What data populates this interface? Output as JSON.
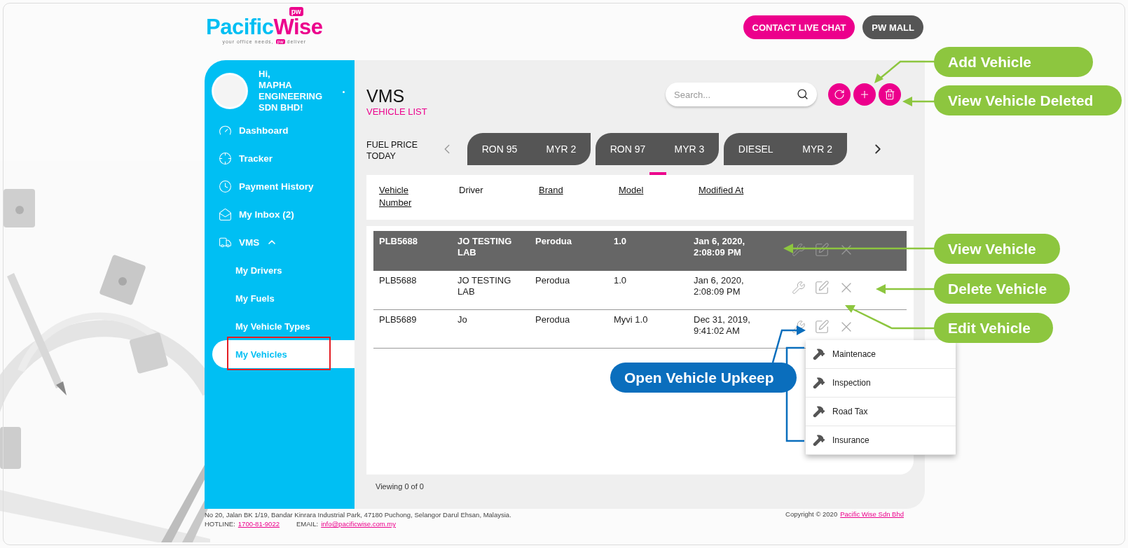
{
  "header": {
    "logo": {
      "word_1": "Pacific",
      "word_2": "Wise",
      "badge": "pw",
      "tagline_start": "your office needs,",
      "tagline_badge": "pw",
      "tagline_end": "deliver"
    },
    "buttons": [
      {
        "label": "CONTACT LIVE CHAT",
        "kind": "primary"
      },
      {
        "label": "PW MALL",
        "kind": "dark"
      }
    ]
  },
  "sidebar": {
    "greeting": [
      "Hi,",
      "MAPHA ENGINEERING SDN BHD!"
    ],
    "items": [
      {
        "label": "Dashboard",
        "selected": false
      },
      {
        "label": "Tracker",
        "selected": false
      },
      {
        "label": "Payment History",
        "selected": false
      },
      {
        "label": "My Inbox (2)",
        "selected": false
      },
      {
        "label": "VMS",
        "selected": false,
        "expanded": true,
        "children": [
          {
            "label": "My Drivers",
            "selected": false,
            "marked": false
          },
          {
            "label": "My Fuels",
            "selected": false,
            "marked": false
          },
          {
            "label": "My Vehicle Types",
            "selected": false,
            "marked": false
          },
          {
            "label": "My Vehicles",
            "selected": true,
            "marked": true
          }
        ]
      }
    ]
  },
  "content": {
    "title": "VMS",
    "subtitle": "VEHICLE LIST",
    "search": {
      "placeholder": "Search..."
    },
    "fuel": {
      "label": "FUEL PRICE TODAY",
      "prices": [
        {
          "fuel": "RON 95",
          "price": "MYR 2",
          "selected": false
        },
        {
          "fuel": "RON 97",
          "price": "MYR 3",
          "selected": true
        },
        {
          "fuel": "DIESEL",
          "price": "MYR 2",
          "selected": false
        }
      ]
    },
    "table": {
      "columns": [
        {
          "label": "Vehicle Number",
          "sortable": true
        },
        {
          "label": "Driver",
          "sortable": false
        },
        {
          "label": "Brand",
          "sortable": true
        },
        {
          "label": "Model",
          "sortable": true
        },
        {
          "label": "Modified At",
          "sortable": true
        }
      ],
      "rows": [
        {
          "cells": [
            "PLB5688",
            "JO TESTING LAB",
            "Perodua",
            "1.0",
            "Jan 6, 2020, 2:08:09 PM"
          ],
          "selected": true
        },
        {
          "cells": [
            "PLB5688",
            "JO TESTING LAB",
            "Perodua",
            "1.0",
            "Jan 6, 2020, 2:08:09 PM"
          ],
          "selected": false
        },
        {
          "cells": [
            "PLB5689",
            "Jo",
            "Perodua",
            "Myvi 1.0",
            "Dec 31, 2019, 9:41:02 AM"
          ],
          "selected": false
        }
      ]
    },
    "upkeep_menu": [
      "Maintenace",
      "Inspection",
      "Road Tax",
      "Insurance"
    ],
    "status": "Viewing 0 of 0"
  },
  "footer": {
    "address": "No 20, Jalan BK 1/19, Bandar Kinrara Industrial Park, 47180 Puchong, Selangor Darul Ehsan, Malaysia.",
    "hotline_label": "HOTLINE:",
    "hotline": "1700-81-9022",
    "email_label": "EMAIL:",
    "email": "info@pacificwise.com.my",
    "copyright": "Copyright © 2020",
    "company": "Pacific Wise Sdn Bhd"
  },
  "callouts": [
    {
      "text": "Add Vehicle",
      "kind": "green"
    },
    {
      "text": "View Vehicle Deleted",
      "kind": "green"
    },
    {
      "text": "View Vehicle",
      "kind": "green"
    },
    {
      "text": "Delete Vehicle",
      "kind": "green"
    },
    {
      "text": "Edit Vehicle",
      "kind": "green"
    },
    {
      "text": "Open Vehicle Upkeep",
      "kind": "blue"
    }
  ]
}
